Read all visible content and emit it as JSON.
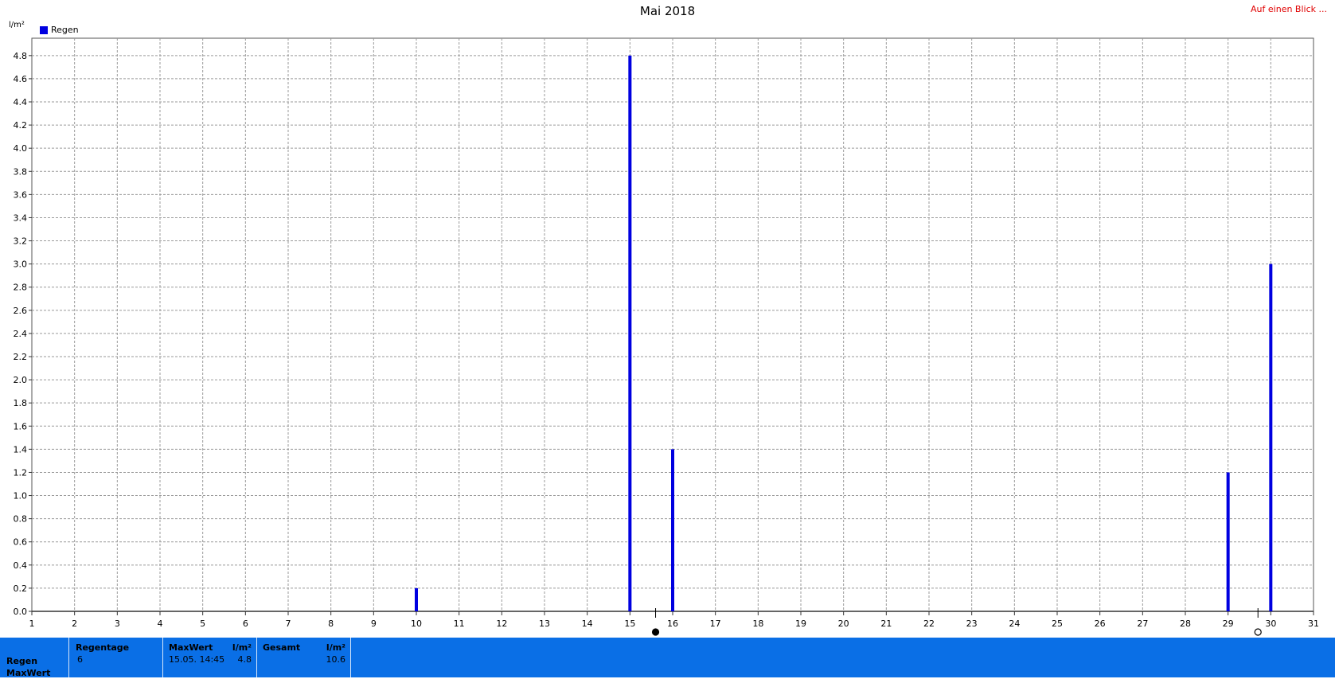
{
  "title": "Mai 2018",
  "corner_link": "Auf einen Blick ...",
  "y_unit": "l/m²",
  "legend_label": "Regen",
  "stats": {
    "row_labels": [
      "Regen",
      "MaxWert"
    ],
    "rain_days_header": "Regentage",
    "rain_days_value": "6",
    "max_header": "MaxWert",
    "max_unit": "l/m²",
    "max_time": "15.05. 14:45",
    "max_value": "4.8",
    "total_header": "Gesamt",
    "total_unit": "l/m²",
    "total_value": "10.6"
  },
  "colors": {
    "series": "#0000e0",
    "stats_bg": "#0a6fe6",
    "link": "#e00000"
  },
  "chart_data": {
    "type": "bar",
    "title": "Mai 2018",
    "ylabel": "l/m²",
    "xlim": [
      1,
      31
    ],
    "ylim": [
      0,
      4.8
    ],
    "x_ticks": [
      1,
      2,
      3,
      4,
      5,
      6,
      7,
      8,
      9,
      10,
      11,
      12,
      13,
      14,
      15,
      16,
      17,
      18,
      19,
      20,
      21,
      22,
      23,
      24,
      25,
      26,
      27,
      28,
      29,
      30,
      31
    ],
    "y_ticks": [
      "0.0",
      "0.2",
      "0.4",
      "0.6",
      "0.8",
      "1.0",
      "1.2",
      "1.4",
      "1.6",
      "1.8",
      "2.0",
      "2.2",
      "2.4",
      "2.6",
      "2.8",
      "3.0",
      "3.2",
      "3.4",
      "3.6",
      "3.8",
      "4.0",
      "4.2",
      "4.4",
      "4.6",
      "4.8"
    ],
    "grid": true,
    "legend": "top-left",
    "series": [
      {
        "name": "Regen",
        "points": [
          {
            "x": 10,
            "y": 0.2
          },
          {
            "x": 15,
            "y": 4.8
          },
          {
            "x": 16,
            "y": 1.4
          },
          {
            "x": 29,
            "y": 1.2
          },
          {
            "x": 30,
            "y": 3.0
          }
        ]
      }
    ],
    "markers": [
      {
        "x": 15.6,
        "style": "filled"
      },
      {
        "x": 29.7,
        "style": "hollow"
      }
    ]
  }
}
